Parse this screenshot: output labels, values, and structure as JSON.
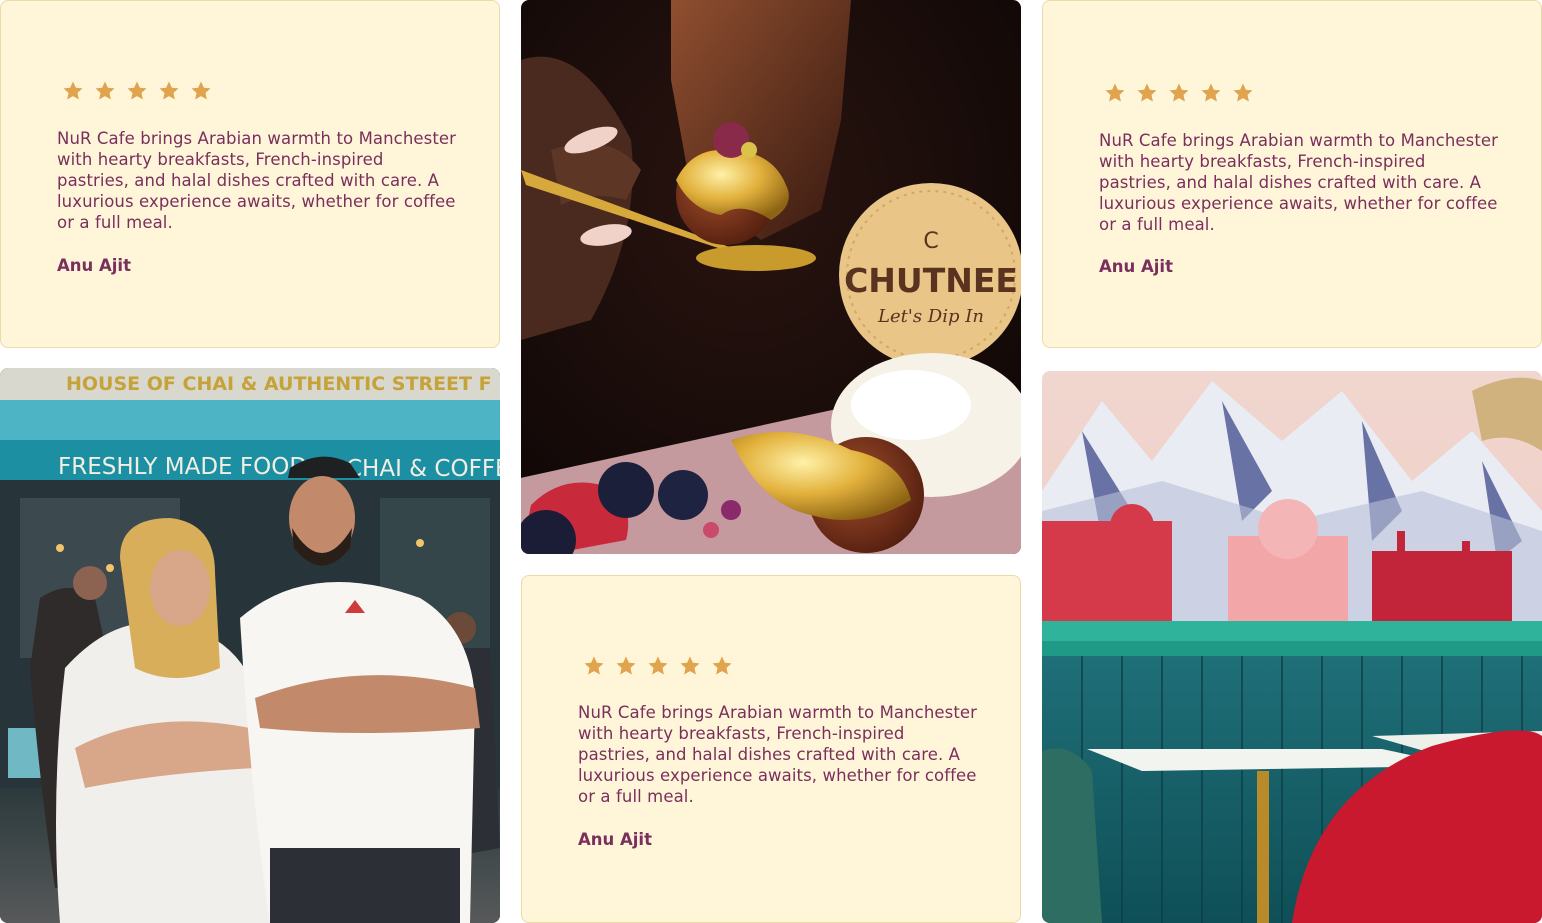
{
  "testimonials": [
    {
      "rating": 5,
      "quote": "NuR Cafe brings Arabian warmth to Manchester with hearty breakfasts, French-inspired pastries, and halal dishes crafted with care. A luxurious experience awaits, whether for coffee or a full meal.",
      "author": "Anu Ajit"
    },
    {
      "rating": 5,
      "quote": "NuR Cafe brings Arabian warmth to Manchester with hearty breakfasts, French-inspired pastries, and halal dishes crafted with care. A luxurious experience awaits, whether for coffee or a full meal.",
      "author": "Anu Ajit"
    },
    {
      "rating": 5,
      "quote": "NuR Cafe brings Arabian warmth to Manchester with hearty breakfasts, French-inspired pastries, and halal dishes crafted with care. A luxurious experience awaits, whether for coffee or a full meal.",
      "author": "Anu Ajit"
    }
  ],
  "photos": {
    "storefront": {
      "sign_top": "HOUSE OF CHAI & AUTHENTIC STREET F",
      "sign_left": "FRESHLY MADE FOOD",
      "sign_right": "CHAI & COFFEE"
    },
    "dessert": {
      "cookie_letter": "C",
      "cookie_brand": "CHUTNEE",
      "cookie_tagline": "Let's Dip In"
    },
    "interior": {}
  },
  "colors": {
    "card_bg": "#fff6d9",
    "text": "#7a2f5c",
    "star": "#e0a44e"
  }
}
